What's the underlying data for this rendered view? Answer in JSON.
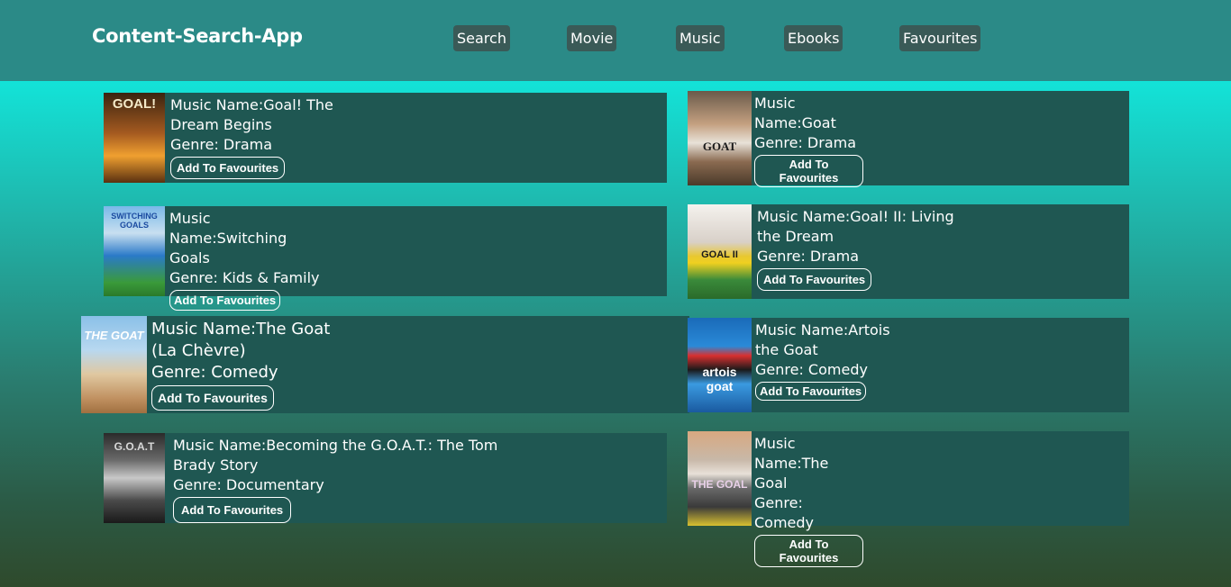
{
  "header": {
    "title": "Content-Search-App",
    "nav": [
      "Search",
      "Movie",
      "Music",
      "Ebooks",
      "Favourites"
    ]
  },
  "labels": {
    "name_prefix": "Music Name:",
    "genre_prefix": "Genre: ",
    "fav_button": "Add To Favourites"
  },
  "cards": [
    {
      "name": "Music Name:Goal! The Dream Begins",
      "genre": "Genre: Drama",
      "poster_text": "GOAL!"
    },
    {
      "name": "Music Name:Goat",
      "genre": "Genre: Drama",
      "poster_text": "GOAT"
    },
    {
      "name": "Music Name:Switching Goals",
      "genre": "Genre: Kids & Family",
      "poster_text": "SWITCHING GOALS"
    },
    {
      "name": "Music Name:Goal! II: Living the Dream",
      "genre": "Genre: Drama",
      "poster_text": "GOAL II"
    },
    {
      "name": "Music Name:The Goat (La Chèvre)",
      "genre": "Genre: Comedy",
      "poster_text": "THE GOAT"
    },
    {
      "name": "Music Name:Artois the Goat",
      "genre": "Genre: Comedy",
      "poster_text": "artois goat"
    },
    {
      "name": "Music Name:Becoming the G.O.A.T.: The Tom Brady Story",
      "genre": "Genre: Documentary",
      "poster_text": "G.O.A.T"
    },
    {
      "name": "Music Name:The Goal",
      "genre": "Genre: Comedy",
      "poster_text": "THE GOAL"
    }
  ],
  "colors": {
    "header_bg": "#2b8a87",
    "card_bg": "#1f5752",
    "nav_bg": "#3a5a57",
    "page_top": "#13e3d8",
    "page_bottom": "#2f4a2c"
  }
}
